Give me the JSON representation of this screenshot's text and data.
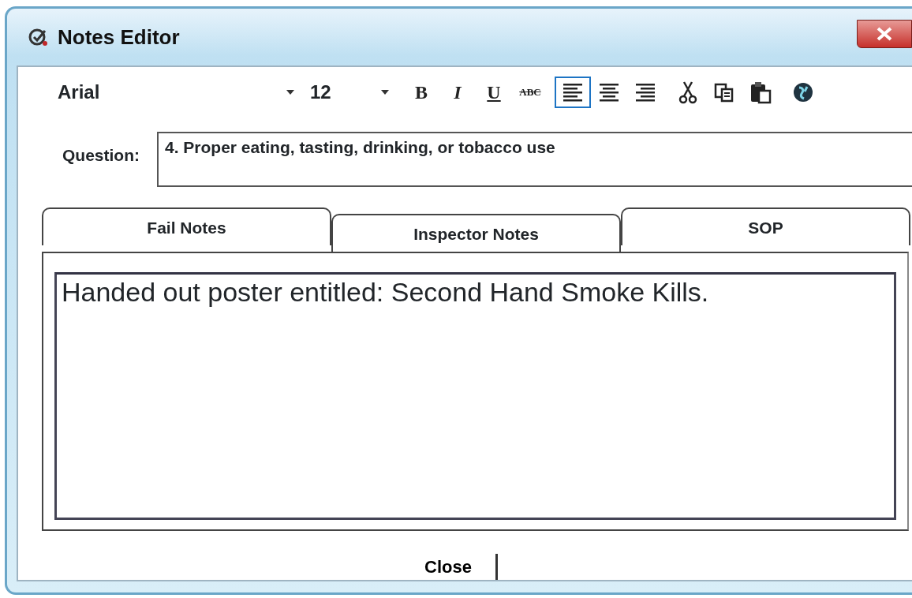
{
  "window": {
    "title": "Notes Editor"
  },
  "toolbar": {
    "font": "Arial",
    "size": "12",
    "format_buttons": [
      {
        "kind": "bold",
        "label": "B"
      },
      {
        "kind": "italic",
        "label": "I"
      },
      {
        "kind": "underline",
        "label": "U"
      },
      {
        "kind": "strike",
        "label": "ABC"
      }
    ],
    "align_buttons": [
      {
        "kind": "left",
        "selected": true
      },
      {
        "kind": "center",
        "selected": false
      },
      {
        "kind": "right",
        "selected": false
      }
    ],
    "edit_buttons": [
      {
        "kind": "cut"
      },
      {
        "kind": "copy"
      },
      {
        "kind": "paste"
      }
    ],
    "extra_buttons": [
      {
        "kind": "globe"
      }
    ]
  },
  "question": {
    "label": "Question:",
    "value": "4. Proper eating, tasting, drinking, or tobacco use"
  },
  "tabs": [
    {
      "label": "Fail Notes",
      "selected": false
    },
    {
      "label": "Inspector Notes",
      "selected": true
    },
    {
      "label": "SOP",
      "selected": false
    }
  ],
  "notes": {
    "value": "Handed out poster entitled: Second Hand Smoke Kills."
  },
  "buttons": [
    "Close"
  ]
}
